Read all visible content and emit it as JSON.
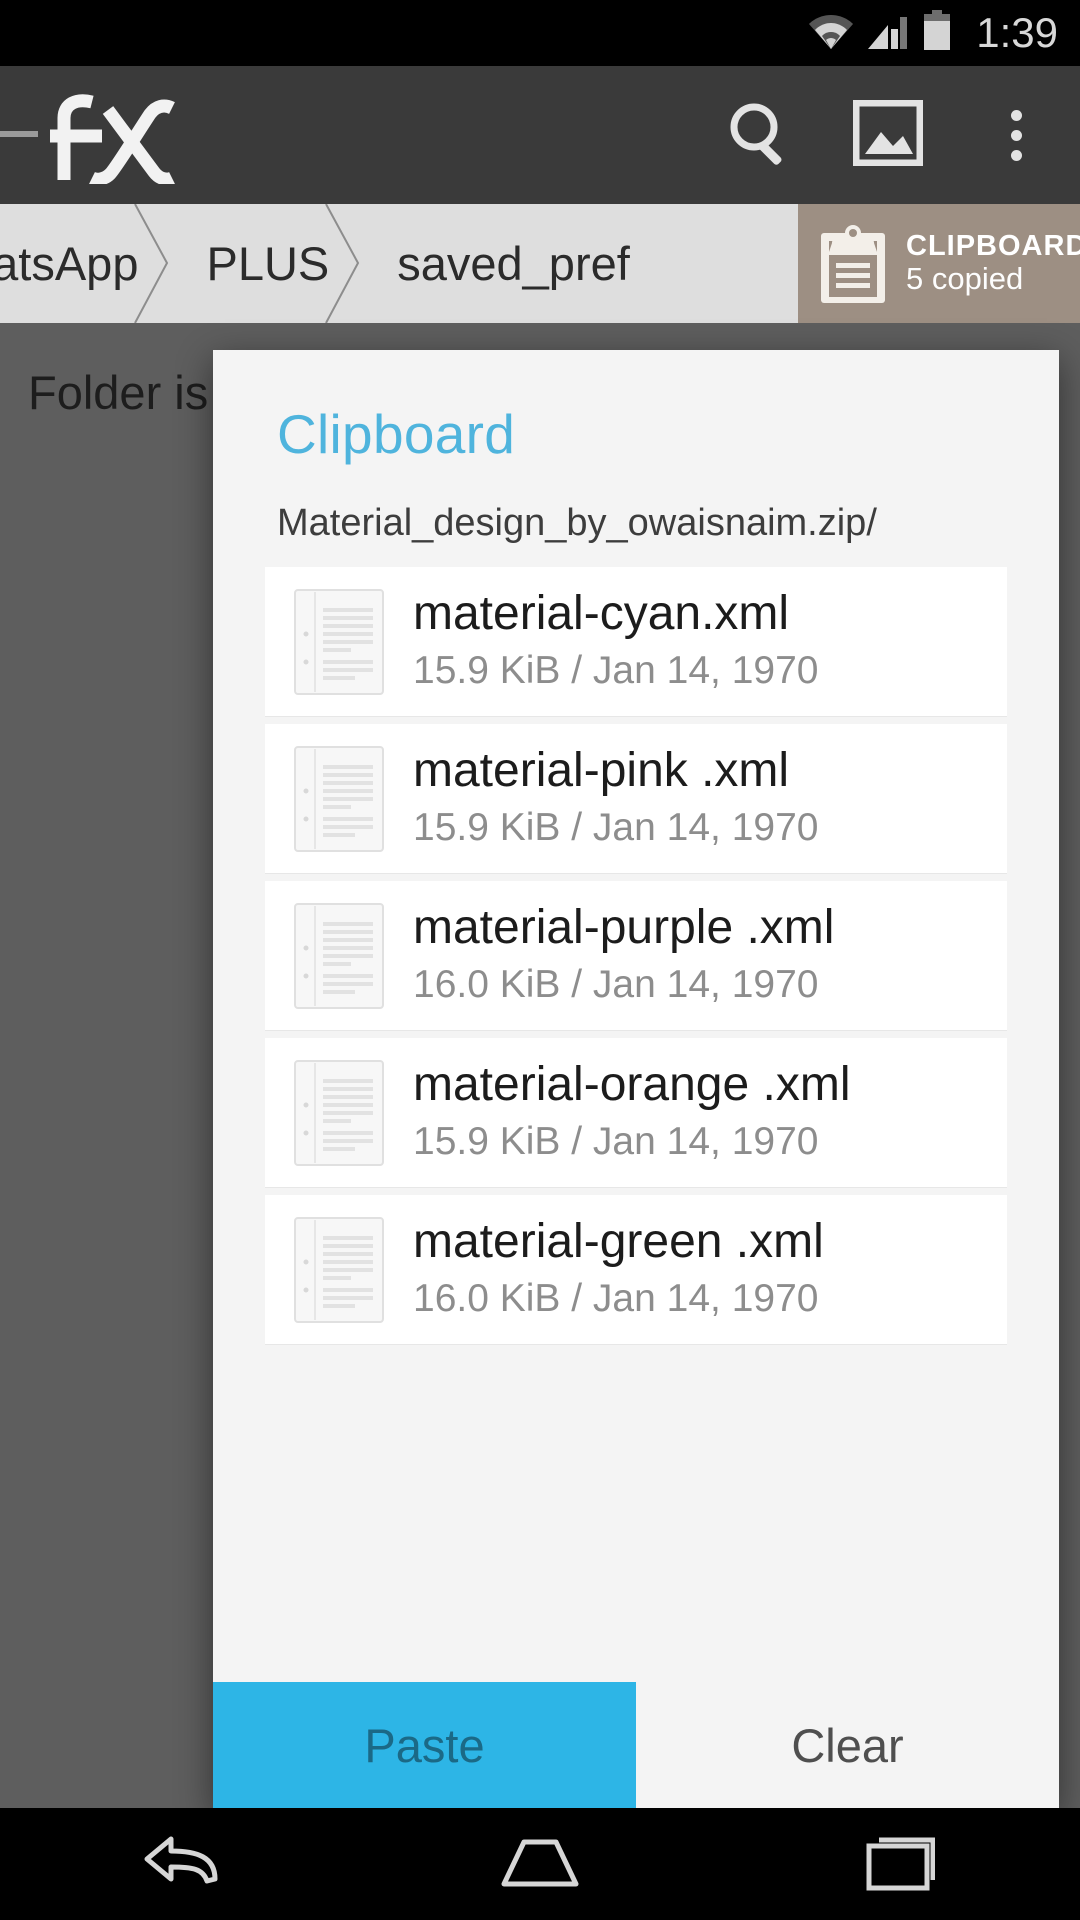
{
  "status_bar": {
    "time": "1:39",
    "icons": [
      "wifi-icon",
      "cellular-signal-icon",
      "battery-icon"
    ]
  },
  "app_bar": {
    "logo_label": "fx",
    "actions": [
      {
        "name": "search-icon",
        "label": "Search"
      },
      {
        "name": "image-icon",
        "label": "Images"
      },
      {
        "name": "overflow-menu-icon",
        "label": "More options"
      }
    ]
  },
  "breadcrumb": {
    "items": [
      {
        "label": "hatsApp"
      },
      {
        "label": "PLUS"
      },
      {
        "label": "saved_pref"
      }
    ],
    "clipboard_chip": {
      "title": "CLIPBOARD",
      "subtitle": "5 copied",
      "icon": "clipboard-icon",
      "background": "#9d8f83"
    }
  },
  "background": {
    "empty_message": "Folder is"
  },
  "dialog": {
    "title": "Clipboard",
    "title_color": "#4fb4dd",
    "path": "Material_design_by_owaisnaim.zip/",
    "files": [
      {
        "name": "material-cyan.xml",
        "meta": "15.9 KiB / Jan 14, 1970",
        "icon": "document-icon"
      },
      {
        "name": "material-pink .xml",
        "meta": "15.9 KiB / Jan 14, 1970",
        "icon": "document-icon"
      },
      {
        "name": "material-purple .xml",
        "meta": "16.0 KiB / Jan 14, 1970",
        "icon": "document-icon"
      },
      {
        "name": "material-orange .xml",
        "meta": "15.9 KiB / Jan 14, 1970",
        "icon": "document-icon"
      },
      {
        "name": "material-green .xml",
        "meta": "16.0 KiB / Jan 14, 1970",
        "icon": "document-icon"
      }
    ],
    "actions": {
      "paste_label": "Paste",
      "paste_color": "#2db5e6",
      "clear_label": "Clear"
    }
  },
  "nav_bar": {
    "buttons": [
      {
        "name": "back-icon",
        "label": "Back"
      },
      {
        "name": "home-icon",
        "label": "Home"
      },
      {
        "name": "recents-icon",
        "label": "Recents"
      }
    ]
  }
}
